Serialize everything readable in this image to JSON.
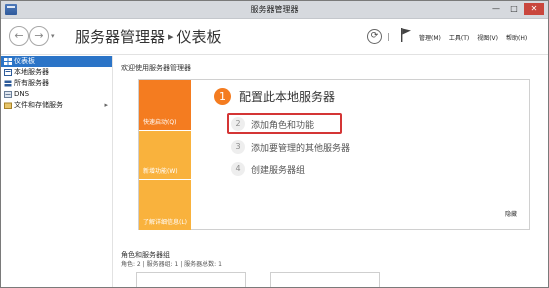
{
  "window": {
    "title": "服务器管理器",
    "controls": {
      "minimize": "—",
      "maximize": "□",
      "close": "✕"
    }
  },
  "header": {
    "breadcrumb": {
      "app": "服务器管理器",
      "separator": "▸",
      "page": "仪表板"
    },
    "menus": [
      "管理(M)",
      "工具(T)",
      "视图(V)",
      "帮助(H)"
    ]
  },
  "sidebar": {
    "items": [
      {
        "label": "仪表板",
        "icon": "dashboard-icon",
        "active": true
      },
      {
        "label": "本地服务器",
        "icon": "server-icon"
      },
      {
        "label": "所有服务器",
        "icon": "servers-icon"
      },
      {
        "label": "DNS",
        "icon": "dns-icon"
      },
      {
        "label": "文件和存储服务",
        "icon": "storage-icon",
        "chevron": "▸"
      }
    ]
  },
  "main": {
    "welcome": "欢迎使用服务器管理器",
    "quick_start": {
      "strip_labels": [
        "快速启动(Q)",
        "新增功能(W)",
        "了解详细信息(L)"
      ],
      "step1": {
        "number": "1",
        "label": "配置此本地服务器"
      },
      "steps": [
        {
          "number": "2",
          "label": "添加角色和功能"
        },
        {
          "number": "3",
          "label": "添加要管理的其他服务器"
        },
        {
          "number": "4",
          "label": "创建服务器组"
        }
      ],
      "hide_label": "隐藏"
    },
    "roles": {
      "title": "角色和服务器组",
      "subtitle": "角色: 2 | 服务器组: 1 | 服务器总数: 1"
    }
  },
  "colors": {
    "accent_orange": "#f47c20",
    "accent_yellow": "#f9b23d",
    "selection_blue": "#2b74c7",
    "highlight_red": "#d43535"
  }
}
